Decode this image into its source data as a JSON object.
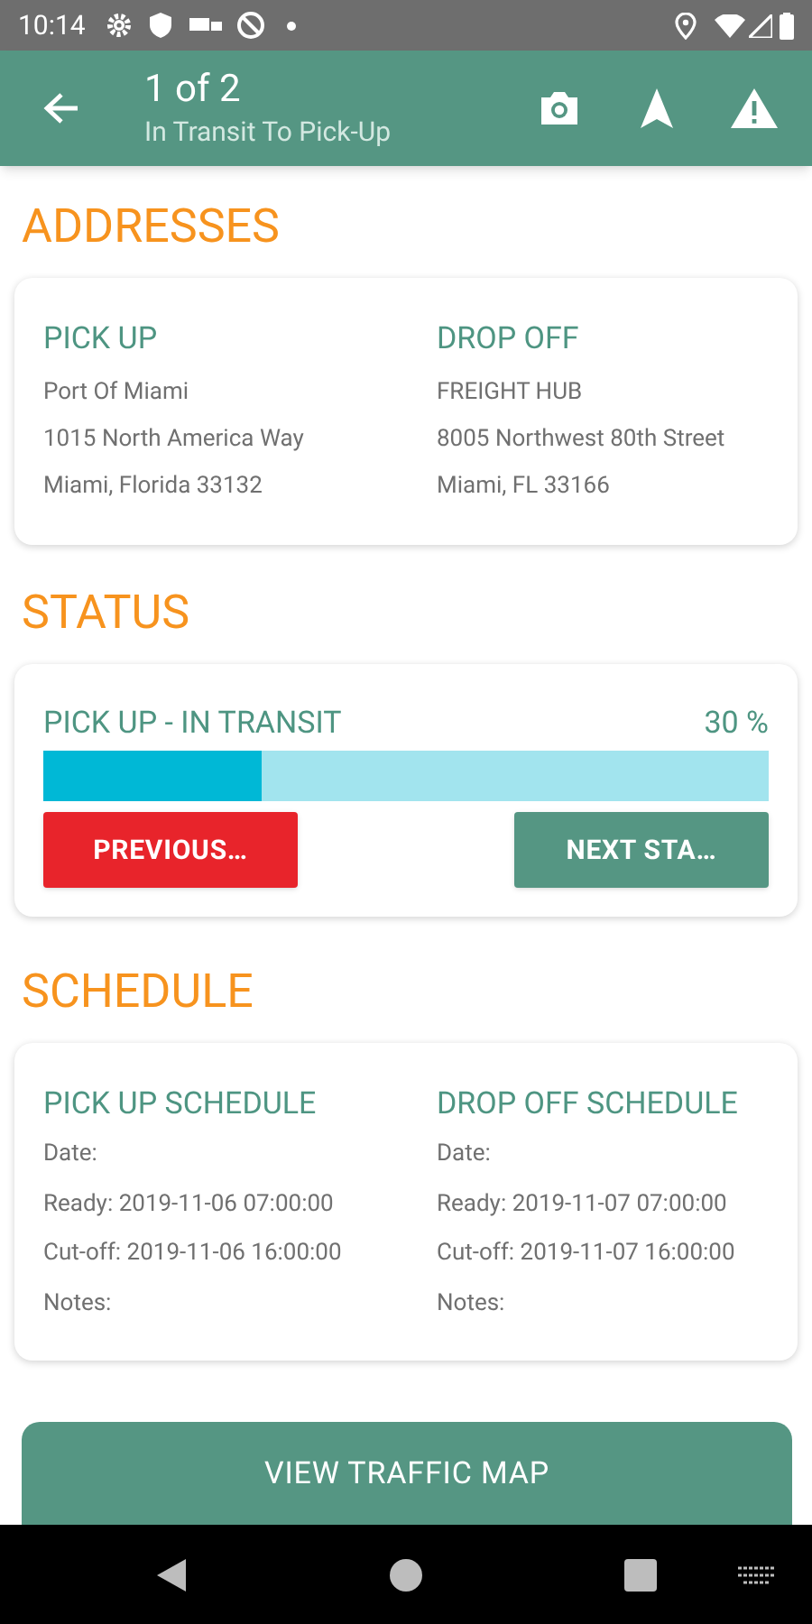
{
  "status_bar": {
    "time": "10:14"
  },
  "app_bar": {
    "title": "1 of 2",
    "subtitle": "In Transit To Pick-Up"
  },
  "addresses": {
    "heading": "ADDRESSES",
    "columns": [
      {
        "label": "PICK UP",
        "lines": [
          "Port Of Miami",
          "1015 North America Way",
          "Miami, Florida 33132"
        ]
      },
      {
        "label": "DROP OFF",
        "lines": [
          "FREIGHT HUB",
          "8005 Northwest 80th Street",
          "Miami, FL 33166"
        ]
      }
    ]
  },
  "status": {
    "heading": "STATUS",
    "label": "PICK UP - IN TRANSIT",
    "percent": "30 %",
    "level": 0.3,
    "previous_button": "PREVIOUS…",
    "next_button": "NEXT STA…"
  },
  "schedule": {
    "heading": "SCHEDULE",
    "columns": [
      {
        "label": "PICK UP SCHEDULE",
        "lines": [
          "Date:",
          "Ready: 2019-11-06 07:00:00",
          "Cut-off: 2019-11-06 16:00:00",
          "Notes:"
        ]
      },
      {
        "label": "DROP OFF SCHEDULE",
        "lines": [
          "Date:",
          "Ready: 2019-11-07 07:00:00",
          "Cut-off: 2019-11-07 16:00:00",
          "Notes:"
        ]
      }
    ]
  },
  "traffic_button": "VIEW TRAFFIC MAP"
}
